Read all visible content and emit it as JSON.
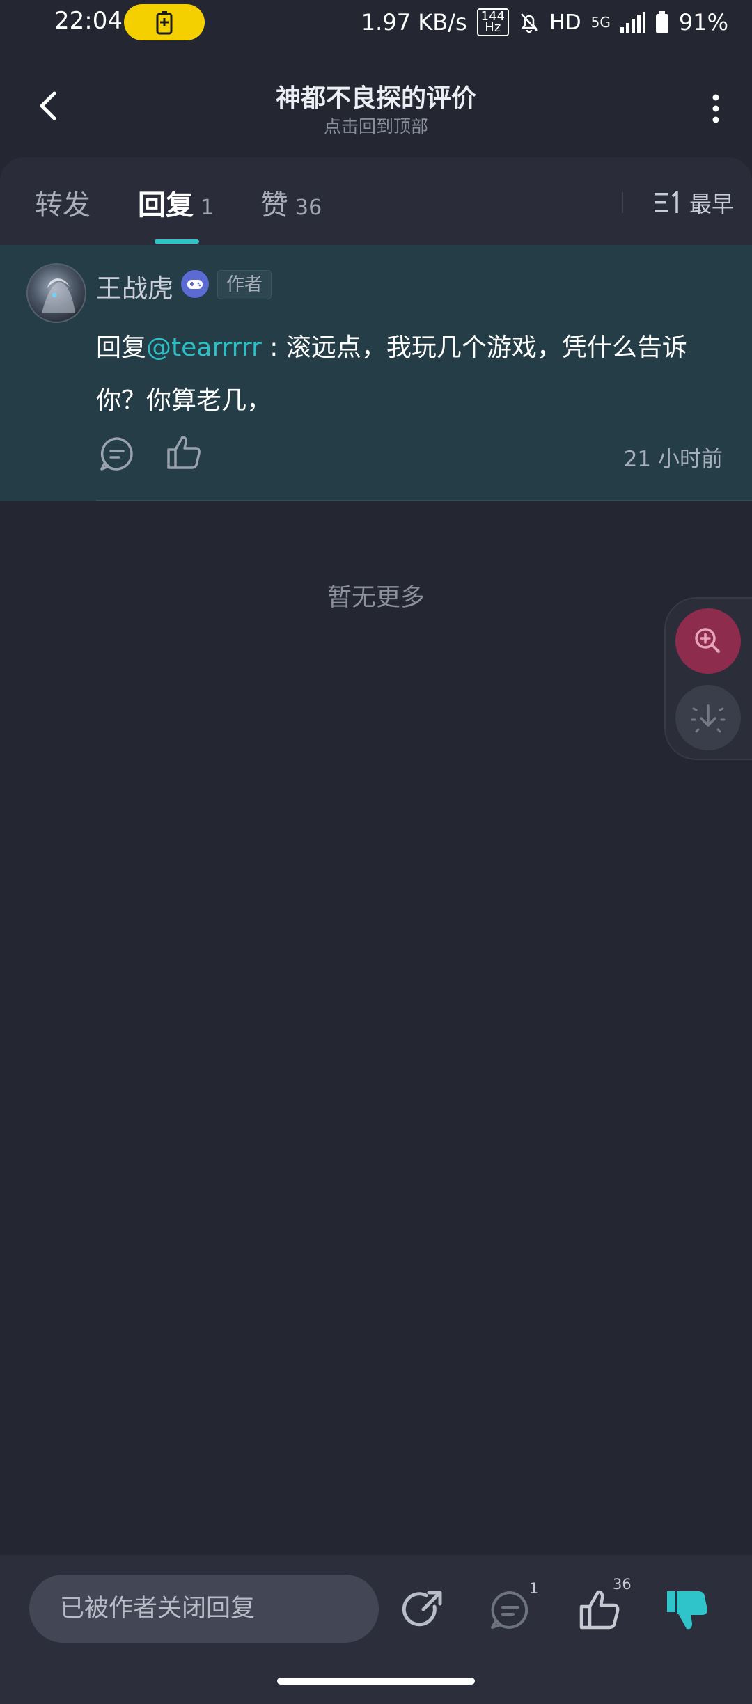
{
  "status_bar": {
    "time": "22:04",
    "net_speed": "1.97 KB/s",
    "refresh_rate": "144",
    "refresh_unit": "Hz",
    "hd": "HD",
    "network": "5G",
    "battery": "91%"
  },
  "header": {
    "title": "神都不良探的评价",
    "subtitle": "点击回到顶部"
  },
  "tabs": [
    {
      "label": "转发",
      "count": ""
    },
    {
      "label": "回复",
      "count": "1"
    },
    {
      "label": "赞",
      "count": "36"
    }
  ],
  "sort": {
    "label": "最早"
  },
  "reply": {
    "username": "王战虎",
    "author_tag": "作者",
    "prefix": "回复",
    "mention": "@tearrrrr",
    "text": " : 滚远点，我玩几个游戏，凭什么告诉你？你算老几，",
    "time": "21 小时前"
  },
  "no_more": "暂无更多",
  "bottom_bar": {
    "input_placeholder": "已被作者关闭回复",
    "comment_count": "1",
    "like_count": "36"
  },
  "colors": {
    "background": "#242632",
    "accent": "#2fc4c9",
    "reply_card": "#243d47",
    "zoom_button": "#8e2c4d"
  },
  "icons": {
    "back": "chevron-left-icon",
    "more": "more-vertical-icon",
    "sort": "sort-icon",
    "comment": "comment-icon",
    "like": "thumbs-up-icon",
    "share": "share-icon",
    "dislike": "thumbs-down-icon",
    "zoom": "zoom-in-icon",
    "download": "download-icon",
    "game": "gamepad-icon"
  }
}
